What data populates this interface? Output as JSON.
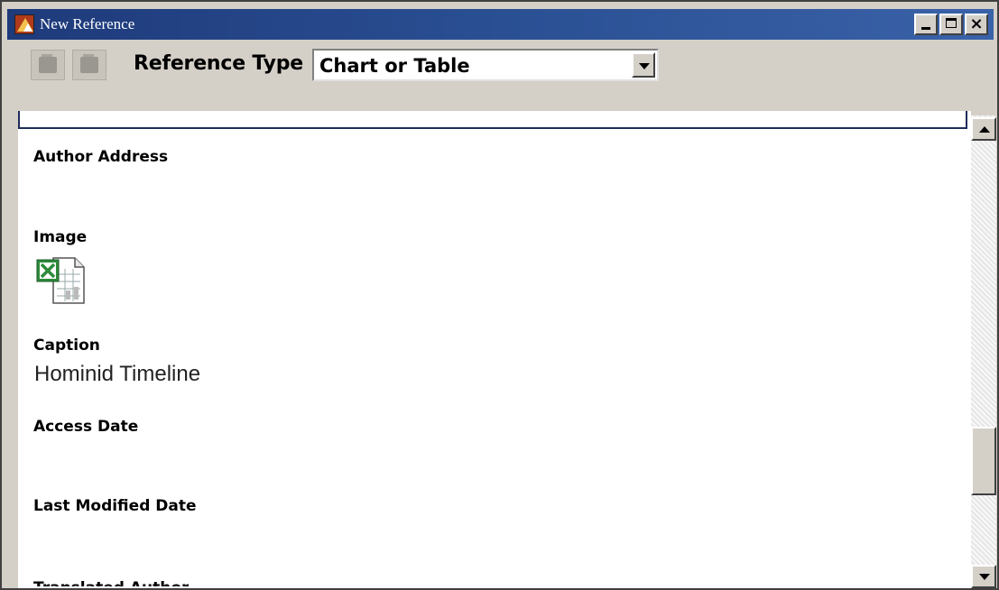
{
  "window": {
    "title": "New Reference"
  },
  "toolbar": {
    "reference_type_label": "Reference Type",
    "reference_type_value": "Chart or Table"
  },
  "fields": {
    "author_address_label": "Author Address",
    "image_label": "Image",
    "caption_label": "Caption",
    "caption_value": "Hominid Timeline",
    "access_date_label": "Access Date",
    "last_modified_label": "Last Modified Date",
    "translated_author_label": "Translated Author"
  },
  "colors": {
    "titlebar": "#1e3a7a",
    "chrome": "#d4d0c8",
    "content": "#ffffff"
  },
  "icons": [
    "app-icon",
    "back-icon",
    "folder-icon",
    "minimize-icon",
    "maximize-icon",
    "close-icon",
    "dropdown-arrow-icon",
    "excel-file-icon",
    "scroll-up-icon",
    "scroll-down-icon"
  ]
}
